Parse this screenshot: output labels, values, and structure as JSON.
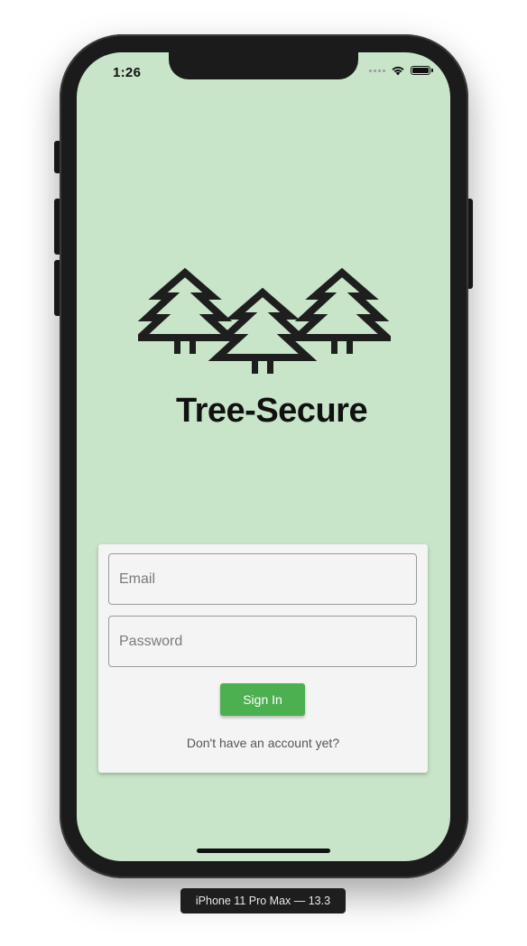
{
  "status_bar": {
    "time": "1:26"
  },
  "app": {
    "brand_name": "Tree-Secure",
    "logo_icon": "pine-trees-icon"
  },
  "login_form": {
    "email_placeholder": "Email",
    "password_placeholder": "Password",
    "sign_in_label": "Sign In",
    "signup_prompt": "Don't have an account yet?"
  },
  "simulator": {
    "device_label": "iPhone 11 Pro Max — 13.3"
  },
  "colors": {
    "screen_background": "#c8e5c9",
    "card_background": "#f4f4f4",
    "primary_button": "#4caf50"
  }
}
